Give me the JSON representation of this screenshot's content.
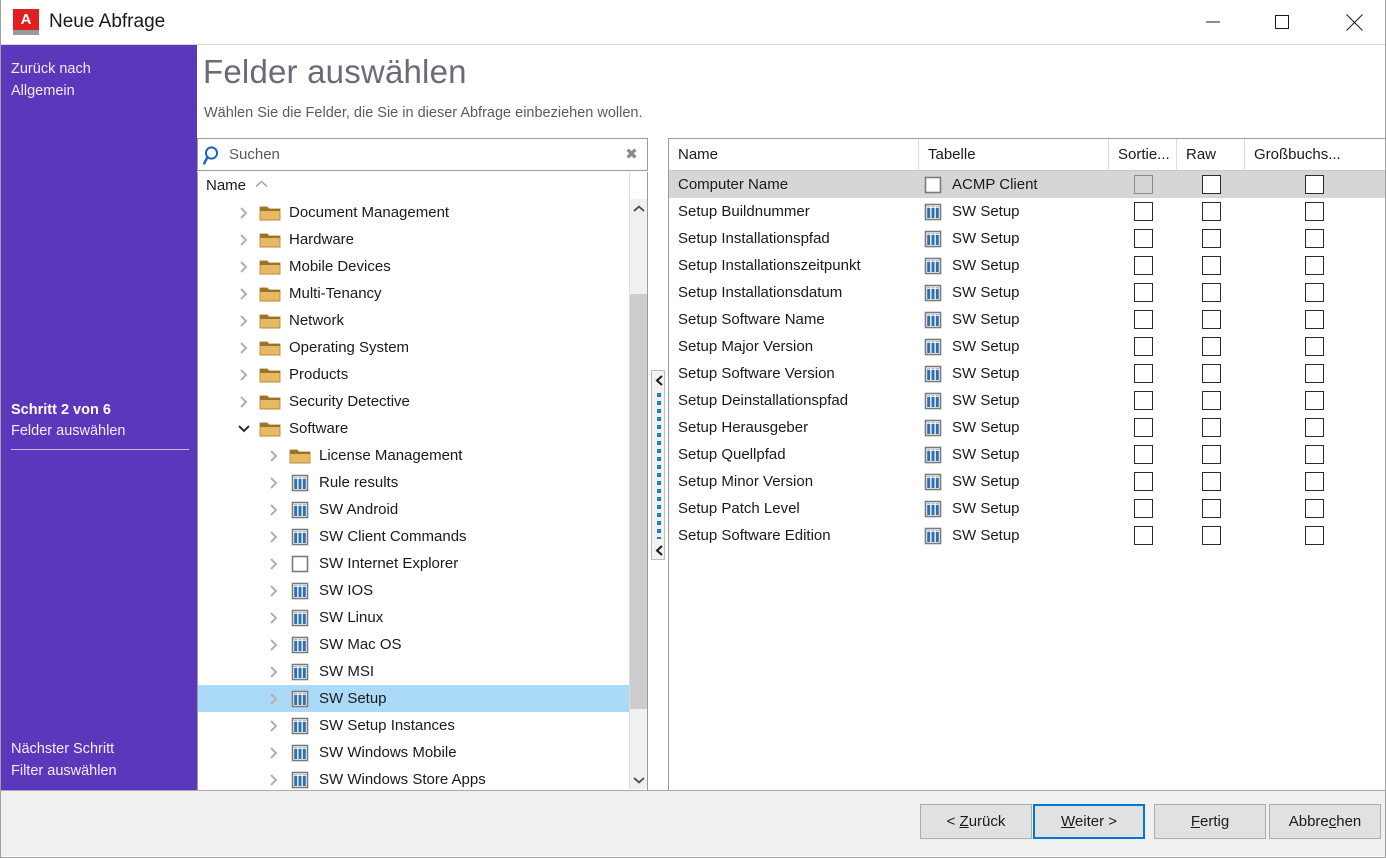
{
  "window": {
    "title": "Neue Abfrage",
    "app_icon": "acmp-a-icon",
    "controls": {
      "minimize": "minimize-icon",
      "maximize": "maximize-icon",
      "close": "close-icon"
    }
  },
  "sidebar": {
    "back_line1": "Zurück nach",
    "back_line2": "Allgemein",
    "step_number": "Schritt 2 von 6",
    "step_label": "Felder auswählen",
    "next_line1": "Nächster Schritt",
    "next_line2": "Filter auswählen",
    "accent_color": "#5b37bc"
  },
  "header": {
    "title": "Felder auswählen",
    "subtitle": "Wählen Sie die Felder, die Sie in dieser Abfrage einbeziehen wollen."
  },
  "search": {
    "placeholder": "Suchen",
    "value": "",
    "icon": "search-icon",
    "clear_icon": "✖"
  },
  "tree": {
    "header_label": "Name",
    "sort_direction": "ascending",
    "items": [
      {
        "label": "Document Management",
        "icon": "folder",
        "indent": 1,
        "expanded": false,
        "selected": false
      },
      {
        "label": "Hardware",
        "icon": "folder",
        "indent": 1,
        "expanded": false,
        "selected": false
      },
      {
        "label": "Mobile Devices",
        "icon": "folder",
        "indent": 1,
        "expanded": false,
        "selected": false
      },
      {
        "label": "Multi-Tenancy",
        "icon": "folder",
        "indent": 1,
        "expanded": false,
        "selected": false
      },
      {
        "label": "Network",
        "icon": "folder",
        "indent": 1,
        "expanded": false,
        "selected": false
      },
      {
        "label": "Operating System",
        "icon": "folder",
        "indent": 1,
        "expanded": false,
        "selected": false
      },
      {
        "label": "Products",
        "icon": "folder",
        "indent": 1,
        "expanded": false,
        "selected": false
      },
      {
        "label": "Security Detective",
        "icon": "folder",
        "indent": 1,
        "expanded": false,
        "selected": false
      },
      {
        "label": "Software",
        "icon": "folder",
        "indent": 1,
        "expanded": true,
        "selected": false
      },
      {
        "label": "License Management",
        "icon": "folder",
        "indent": 2,
        "expanded": false,
        "selected": false
      },
      {
        "label": "Rule results",
        "icon": "table",
        "indent": 2,
        "expanded": false,
        "selected": false
      },
      {
        "label": "SW Android",
        "icon": "table",
        "indent": 2,
        "expanded": false,
        "selected": false
      },
      {
        "label": "SW Client Commands",
        "icon": "table",
        "indent": 2,
        "expanded": false,
        "selected": false
      },
      {
        "label": "SW Internet Explorer",
        "icon": "table-empty",
        "indent": 2,
        "expanded": false,
        "selected": false
      },
      {
        "label": "SW IOS",
        "icon": "table",
        "indent": 2,
        "expanded": false,
        "selected": false
      },
      {
        "label": "SW Linux",
        "icon": "table",
        "indent": 2,
        "expanded": false,
        "selected": false
      },
      {
        "label": "SW Mac OS",
        "icon": "table",
        "indent": 2,
        "expanded": false,
        "selected": false
      },
      {
        "label": "SW MSI",
        "icon": "table",
        "indent": 2,
        "expanded": false,
        "selected": false
      },
      {
        "label": "SW Setup",
        "icon": "table",
        "indent": 2,
        "expanded": false,
        "selected": true
      },
      {
        "label": "SW Setup Instances",
        "icon": "table",
        "indent": 2,
        "expanded": false,
        "selected": false
      },
      {
        "label": "SW Windows Mobile",
        "icon": "table",
        "indent": 2,
        "expanded": false,
        "selected": false
      },
      {
        "label": "SW Windows Store Apps",
        "icon": "table",
        "indent": 2,
        "expanded": false,
        "selected": false
      }
    ]
  },
  "splitter": {
    "icon": "collapse-left-icon"
  },
  "grid": {
    "columns": [
      "Name",
      "Tabelle",
      "Sortie...",
      "Raw",
      "Großbuchs..."
    ],
    "rows": [
      {
        "name": "Computer Name",
        "table": "ACMP Client",
        "icon": "table-empty",
        "sort": false,
        "raw": false,
        "upper": false,
        "selected": true
      },
      {
        "name": "Setup Buildnummer",
        "table": "SW Setup",
        "icon": "table",
        "sort": false,
        "raw": false,
        "upper": false,
        "selected": false
      },
      {
        "name": "Setup Installationspfad",
        "table": "SW Setup",
        "icon": "table",
        "sort": false,
        "raw": false,
        "upper": false,
        "selected": false
      },
      {
        "name": "Setup Installationszeitpunkt",
        "table": "SW Setup",
        "icon": "table",
        "sort": false,
        "raw": false,
        "upper": false,
        "selected": false
      },
      {
        "name": "Setup Installationsdatum",
        "table": "SW Setup",
        "icon": "table",
        "sort": false,
        "raw": false,
        "upper": false,
        "selected": false
      },
      {
        "name": "Setup Software Name",
        "table": "SW Setup",
        "icon": "table",
        "sort": false,
        "raw": false,
        "upper": false,
        "selected": false
      },
      {
        "name": "Setup Major Version",
        "table": "SW Setup",
        "icon": "table",
        "sort": false,
        "raw": false,
        "upper": false,
        "selected": false
      },
      {
        "name": "Setup Software Version",
        "table": "SW Setup",
        "icon": "table",
        "sort": false,
        "raw": false,
        "upper": false,
        "selected": false
      },
      {
        "name": "Setup Deinstallationspfad",
        "table": "SW Setup",
        "icon": "table",
        "sort": false,
        "raw": false,
        "upper": false,
        "selected": false
      },
      {
        "name": "Setup Herausgeber",
        "table": "SW Setup",
        "icon": "table",
        "sort": false,
        "raw": false,
        "upper": false,
        "selected": false
      },
      {
        "name": "Setup Quellpfad",
        "table": "SW Setup",
        "icon": "table",
        "sort": false,
        "raw": false,
        "upper": false,
        "selected": false
      },
      {
        "name": "Setup Minor Version",
        "table": "SW Setup",
        "icon": "table",
        "sort": false,
        "raw": false,
        "upper": false,
        "selected": false
      },
      {
        "name": "Setup Patch Level",
        "table": "SW Setup",
        "icon": "table",
        "sort": false,
        "raw": false,
        "upper": false,
        "selected": false
      },
      {
        "name": "Setup Software Edition",
        "table": "SW Setup",
        "icon": "table",
        "sort": false,
        "raw": false,
        "upper": false,
        "selected": false
      }
    ]
  },
  "footer": {
    "back": {
      "pre": "< ",
      "accel": "Z",
      "post": "urück"
    },
    "next": {
      "pre": "",
      "accel": "W",
      "post": "eiter >"
    },
    "finish": {
      "pre": "",
      "accel": "F",
      "post": "ertig"
    },
    "cancel": {
      "pre": "Abbre",
      "accel": "c",
      "post": "hen"
    },
    "focused": "next"
  }
}
